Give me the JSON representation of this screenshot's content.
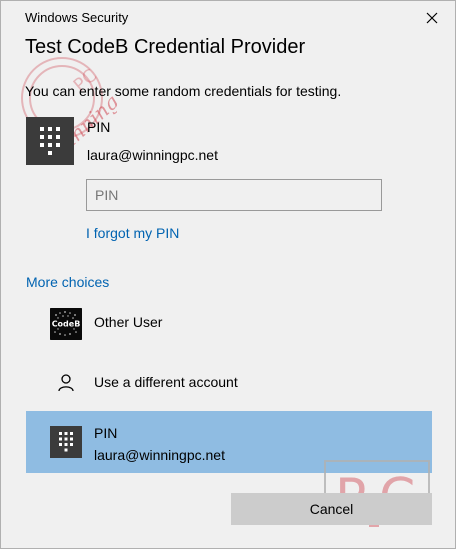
{
  "window": {
    "app_title": "Windows Security",
    "close_glyph": "✕"
  },
  "dialog": {
    "title": "Test CodeB Credential Provider",
    "instructions": "You can enter some random credentials for testing."
  },
  "selected_credential": {
    "icon": "pin-keypad-icon",
    "name": "PIN",
    "user": "laura@winningpc.net",
    "pin_input": {
      "value": "",
      "placeholder": "PIN"
    },
    "forgot_link": "I forgot my PIN"
  },
  "more_choices": {
    "heading": "More choices",
    "items": [
      {
        "icon": "codeb-logo-icon",
        "logo_text": "CodeB",
        "label": "Other User"
      },
      {
        "icon": "person-icon",
        "label": "Use a different account"
      },
      {
        "icon": "pin-keypad-icon",
        "label": "PIN",
        "sublabel": "laura@winningpc.net",
        "selected": true
      }
    ]
  },
  "buttons": {
    "cancel": "Cancel"
  },
  "watermarks": {
    "top_left": "WinningPC",
    "bottom_right": "PC"
  },
  "colors": {
    "background": "#f0f0f0",
    "link": "#0063b1",
    "selected_row": "#8fbce2",
    "tile": "#3b3b3b",
    "button": "#cccccc",
    "watermark": "#d04a55"
  }
}
